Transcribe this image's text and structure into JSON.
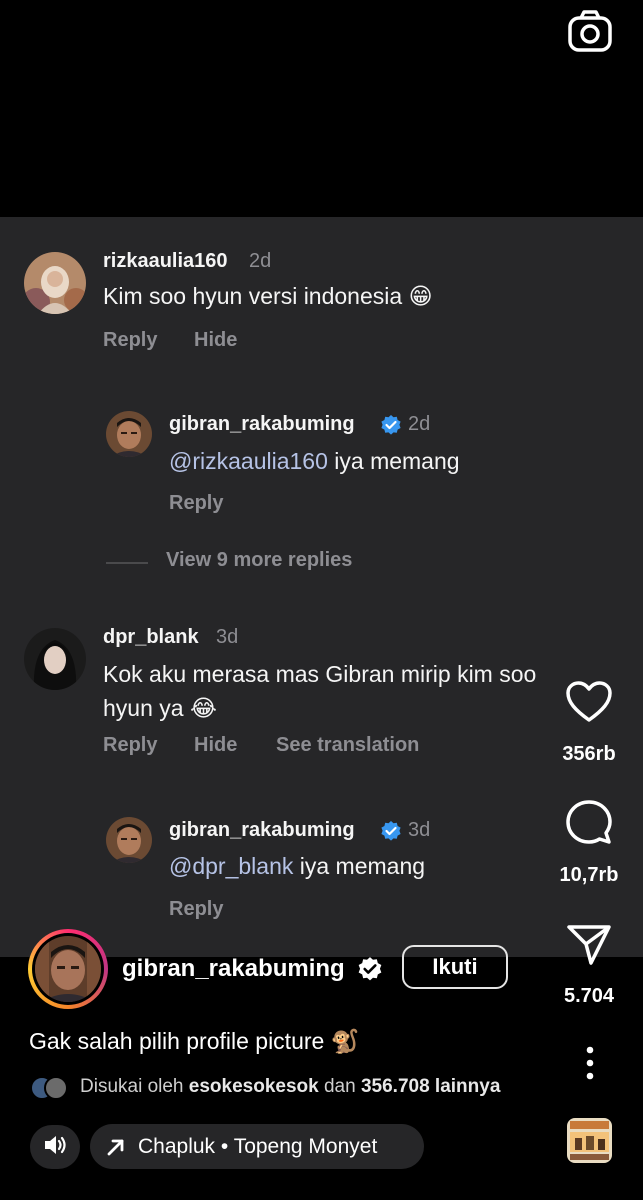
{
  "comments": [
    {
      "username": "rizkaaulia160",
      "time": "2d",
      "text": "Kim soo hyun versi indonesia",
      "emoji": "😁",
      "actions": [
        "Reply",
        "Hide"
      ],
      "reply": {
        "username": "gibran_rakabuming",
        "time": "2d",
        "mention": "@rizkaaulia160",
        "text": " iya memang",
        "action": "Reply"
      },
      "view_more": "View 9 more replies"
    },
    {
      "username": "dpr_blank",
      "time": "3d",
      "text_line1": "Kok aku merasa mas Gibran mirip kim soo",
      "text_line2": "hyun ya",
      "emoji": "😂",
      "actions": [
        "Reply",
        "Hide",
        "See translation"
      ],
      "reply": {
        "username": "gibran_rakabuming",
        "time": "3d",
        "mention": "@dpr_blank",
        "text": " iya memang",
        "action": "Reply"
      }
    }
  ],
  "side_actions": {
    "likes": "356rb",
    "comments": "10,7rb",
    "shares": "5.704"
  },
  "post": {
    "username": "gibran_rakabuming",
    "follow_label": "Ikuti",
    "caption": "Gak salah pilih profile picture",
    "caption_emoji": "🐒",
    "likes_prefix": "Disukai oleh ",
    "likes_user": "esokesokesok",
    "likes_middle": " dan ",
    "likes_count": "356.708 lainnya"
  },
  "music": {
    "label": "Chapluk • Topeng Monyet"
  },
  "icons": {
    "camera": "camera-icon",
    "heart": "heart-icon",
    "comment": "comment-bubble-icon",
    "share": "paper-plane-icon",
    "more": "more-vertical-icon",
    "sound": "speaker-icon",
    "music_arrow": "arrow-up-right-icon",
    "verified": "verified-badge-icon"
  },
  "colors": {
    "panel": "#262628",
    "verified": "#3897f0",
    "muted": "#8e8e93",
    "mention": "#b6c3e6"
  }
}
